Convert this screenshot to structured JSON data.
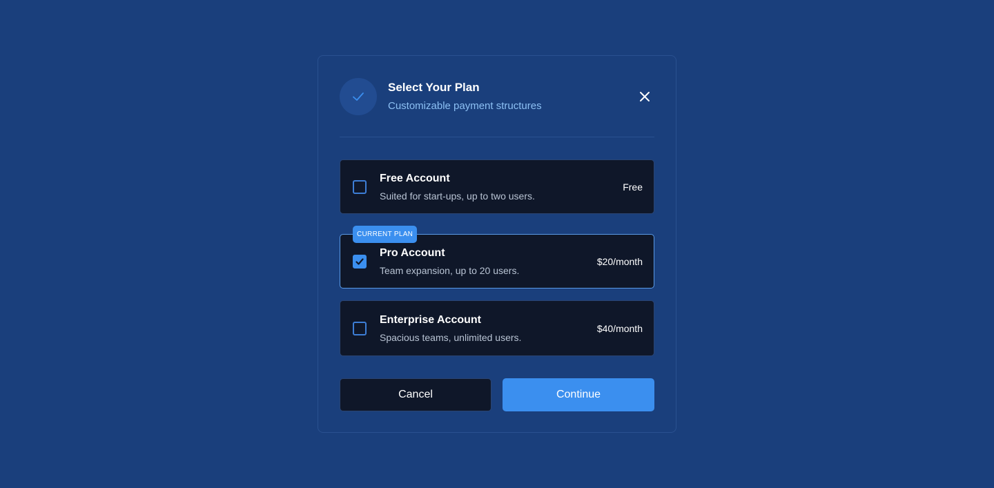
{
  "modal": {
    "title": "Select Your Plan",
    "subtitle": "Customizable payment structures",
    "header_icon": "check-icon",
    "close_icon": "close-icon"
  },
  "plans": [
    {
      "name": "Free Account",
      "description": "Suited for start-ups, up to two users.",
      "price": "Free",
      "checked": false
    },
    {
      "name": "Pro Account",
      "description": "Team expansion, up to 20 users.",
      "price": "$20/month",
      "checked": true,
      "badge": "CURRENT PLAN"
    },
    {
      "name": "Enterprise Account",
      "description": "Spacious teams, unlimited users.",
      "price": "$40/month",
      "checked": false
    }
  ],
  "buttons": {
    "cancel": "Cancel",
    "continue": "Continue"
  },
  "colors": {
    "background": "#1a3f7c",
    "card": "#0f1729",
    "accent": "#3b8fef",
    "subtitle": "#8cc0f4"
  }
}
